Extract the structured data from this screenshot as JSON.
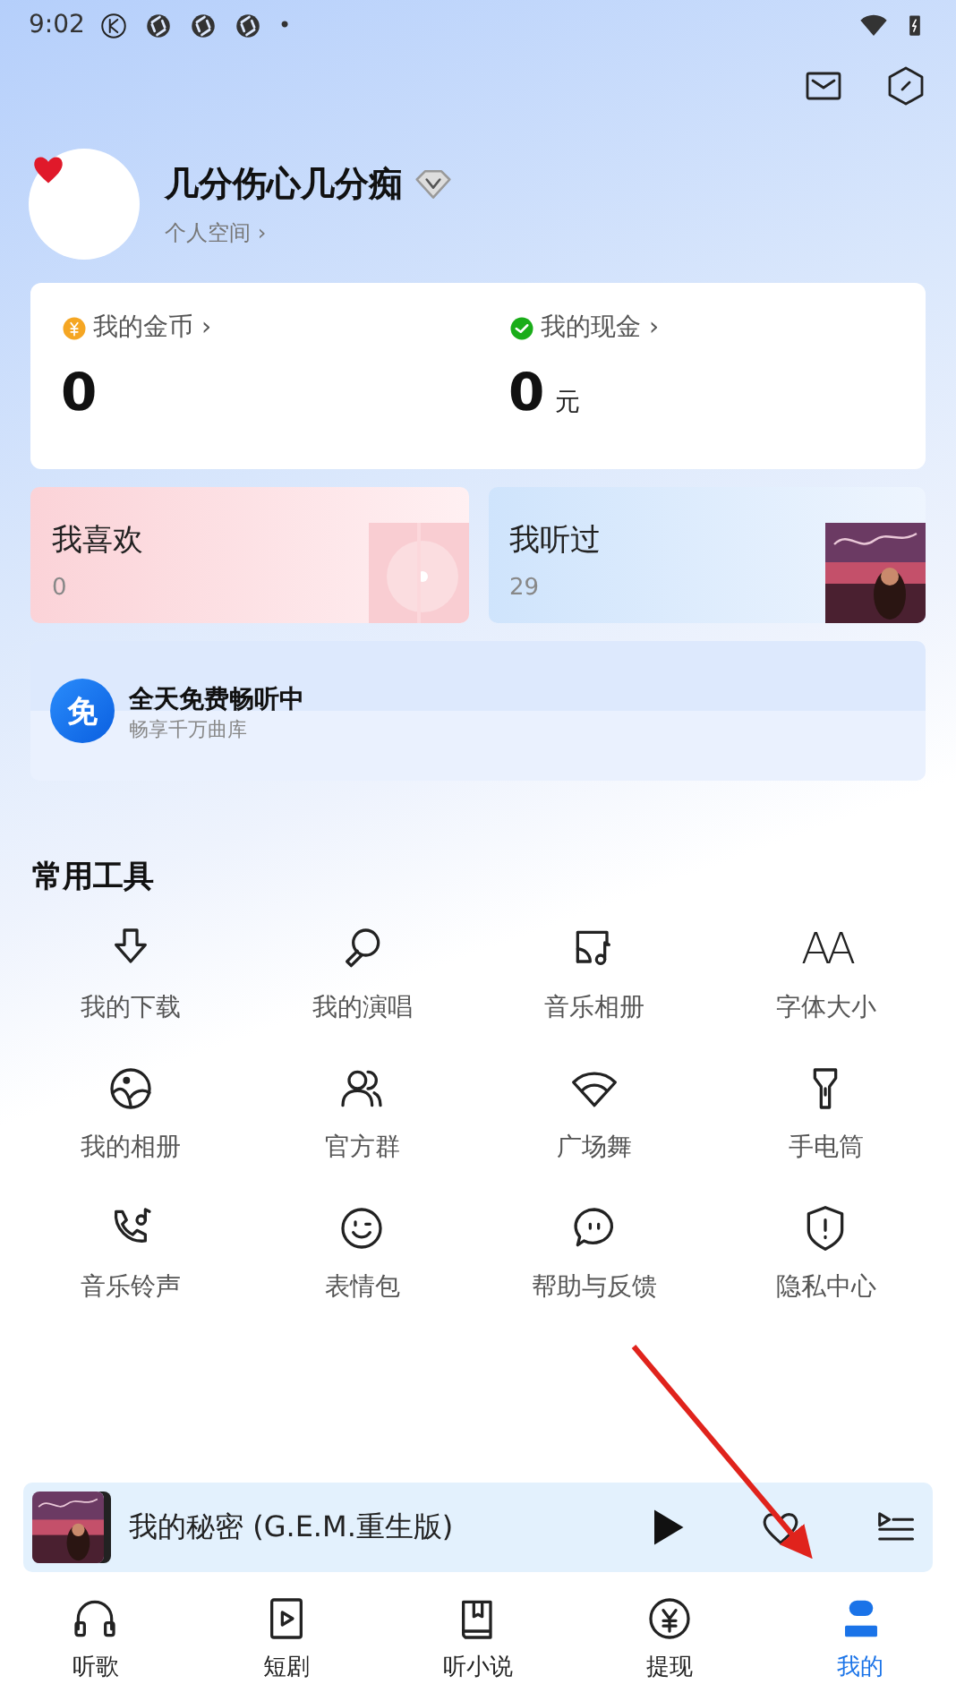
{
  "status_bar": {
    "time": "9:02",
    "dot": "•"
  },
  "profile": {
    "name": "几分伤心几分痴",
    "link": "个人空间",
    "chevron": "›"
  },
  "wallet": [
    {
      "kind": "coin",
      "label": "我的金币",
      "chevron": "›",
      "value": "0"
    },
    {
      "kind": "cash",
      "label": "我的现金",
      "chevron": "›",
      "value": "0",
      "unit": "元"
    }
  ],
  "collections": [
    {
      "kind": "liked",
      "title": "我喜欢",
      "count": "0"
    },
    {
      "kind": "history",
      "title": "我听过",
      "count": "29"
    }
  ],
  "banner": {
    "badge": "免",
    "title": "全天免费畅听中",
    "subtitle": "畅享千万曲库"
  },
  "tools": {
    "title": "常用工具",
    "items": [
      {
        "kind": "download",
        "label": "我的下载"
      },
      {
        "kind": "sing",
        "label": "我的演唱"
      },
      {
        "kind": "album",
        "label": "音乐相册"
      },
      {
        "kind": "font",
        "label": "字体大小",
        "glyph": "AA"
      },
      {
        "kind": "photos",
        "label": "我的相册"
      },
      {
        "kind": "group",
        "label": "官方群"
      },
      {
        "kind": "dance",
        "label": "广场舞"
      },
      {
        "kind": "torch",
        "label": "手电筒"
      },
      {
        "kind": "ringtone",
        "label": "音乐铃声"
      },
      {
        "kind": "emoji",
        "label": "表情包"
      },
      {
        "kind": "help",
        "label": "帮助与反馈"
      },
      {
        "kind": "privacy",
        "label": "隐私中心"
      }
    ]
  },
  "player": {
    "song": "我的秘密 (G.E.M.重生版)",
    "playing": false
  },
  "tabs": [
    {
      "kind": "music",
      "label": "听歌",
      "selected": false
    },
    {
      "kind": "drama",
      "label": "短剧",
      "selected": false
    },
    {
      "kind": "novel",
      "label": "听小说",
      "selected": false
    },
    {
      "kind": "cash",
      "label": "提现",
      "selected": false
    },
    {
      "kind": "me",
      "label": "我的",
      "selected": true
    }
  ]
}
